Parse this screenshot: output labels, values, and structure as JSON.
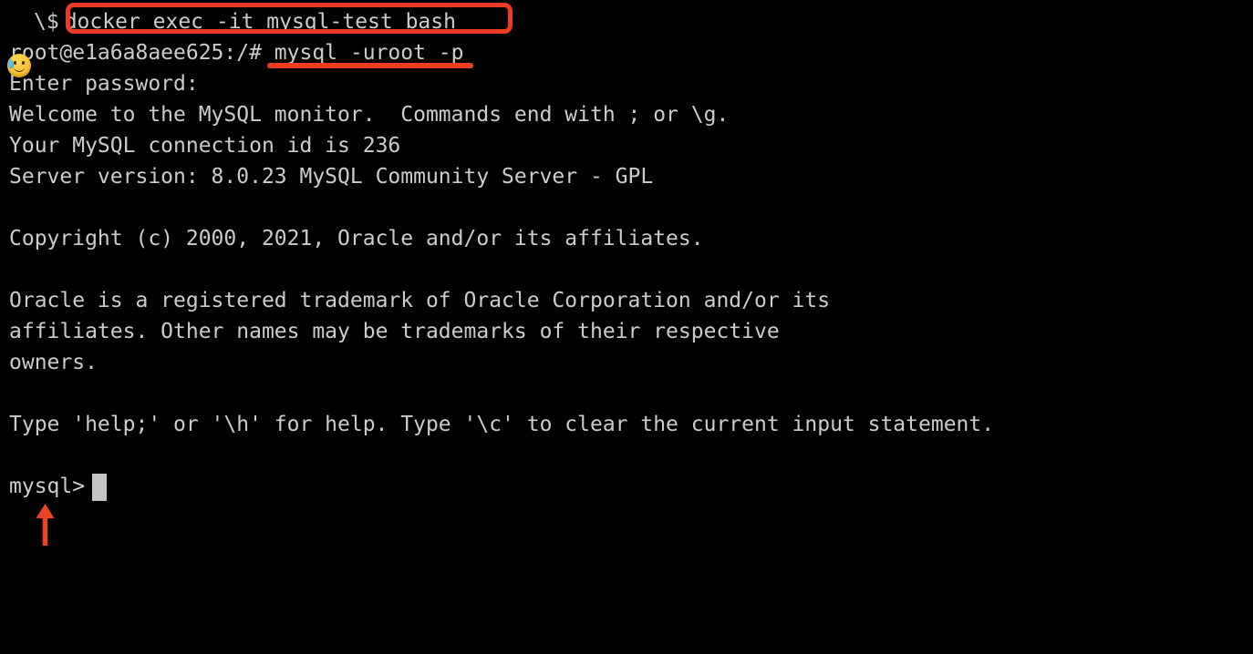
{
  "terminal": {
    "background_color": "#000000",
    "text_color": "#cccccc",
    "font_size_px": 23,
    "line_height_px": 34,
    "host_prompt": {
      "emoji": "sweat-smile-emoji",
      "sigil": "\\$",
      "command": "docker exec -it mysql-test bash"
    },
    "lines": [
      {
        "id": "container-prompt",
        "text": "root@e1a6a8aee625:/# mysql -uroot -p"
      },
      {
        "id": "enter-password",
        "text": "Enter password:"
      },
      {
        "id": "welcome",
        "text": "Welcome to the MySQL monitor.  Commands end with ; or \\g."
      },
      {
        "id": "connection-id",
        "text": "Your MySQL connection id is 236"
      },
      {
        "id": "server-version",
        "text": "Server version: 8.0.23 MySQL Community Server - GPL"
      },
      {
        "id": "blank-1",
        "text": ""
      },
      {
        "id": "copyright",
        "text": "Copyright (c) 2000, 2021, Oracle and/or its affiliates."
      },
      {
        "id": "blank-2",
        "text": ""
      },
      {
        "id": "trademark-1",
        "text": "Oracle is a registered trademark of Oracle Corporation and/or its"
      },
      {
        "id": "trademark-2",
        "text": "affiliates. Other names may be trademarks of their respective"
      },
      {
        "id": "trademark-3",
        "text": "owners."
      },
      {
        "id": "blank-3",
        "text": ""
      },
      {
        "id": "help-hint",
        "text": "Type 'help;' or '\\h' for help. Type '\\c' to clear the current input statement."
      },
      {
        "id": "blank-4",
        "text": ""
      }
    ],
    "mysql_prompt": {
      "label": "mysql>",
      "cursor": "block-cursor",
      "cursor_color": "#c3c3c3"
    }
  },
  "annotations": {
    "accent_color": "#ef3b23",
    "command_box": {
      "name": "docker-command-highlight",
      "target_text": "docker exec -it mysql-test bash"
    },
    "command_underline": {
      "name": "mysql-login-underline",
      "target_text": "mysql -uroot -p"
    },
    "arrow": {
      "name": "mysql-prompt-arrow",
      "direction": "up",
      "points_at": "mysql>"
    }
  }
}
